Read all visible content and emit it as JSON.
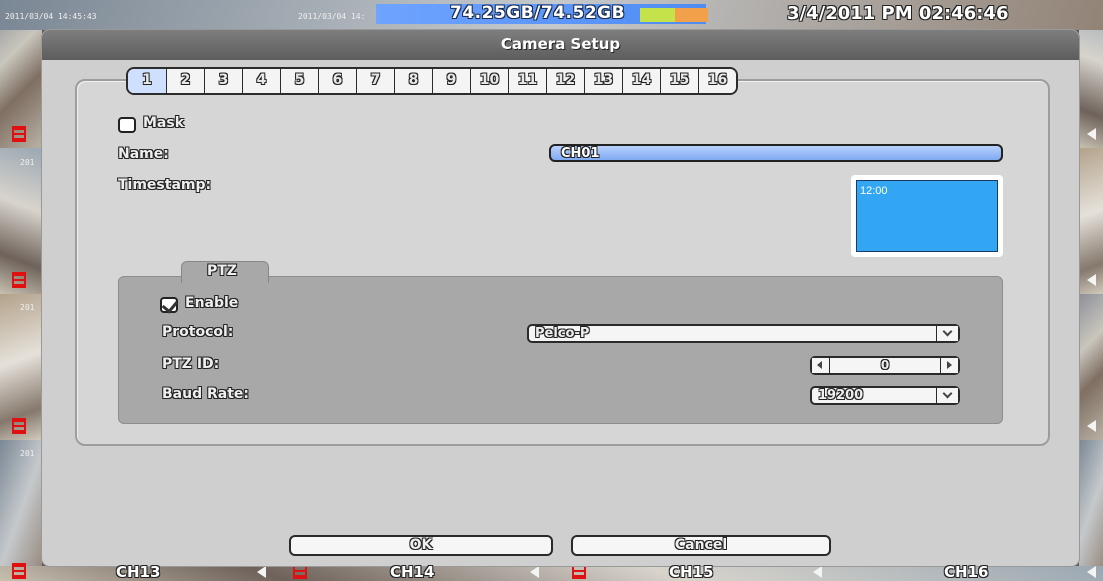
{
  "osd": {
    "feed_timestamp_1": "2011/03/04 14:45:43",
    "feed_timestamp_2": "2011/03/04 14:",
    "feed_partial": "201",
    "storage": "74.25GB/74.52GB",
    "datetime": "3/4/2011 PM 02:46:46",
    "channels": [
      "CH13",
      "CH14",
      "CH15",
      "CH16"
    ]
  },
  "dialog": {
    "title": "Camera Setup",
    "tabs": [
      "1",
      "2",
      "3",
      "4",
      "5",
      "6",
      "7",
      "8",
      "9",
      "10",
      "11",
      "12",
      "13",
      "14",
      "15",
      "16"
    ],
    "active_tab": "1",
    "mask": {
      "label": "Mask",
      "checked": false
    },
    "name": {
      "label": "Name:",
      "value": "CH01"
    },
    "timestamp": {
      "label": "Timestamp:",
      "preview_time": "12:00"
    },
    "ptz": {
      "section_label": "PTZ",
      "enable": {
        "label": "Enable",
        "checked": true
      },
      "protocol": {
        "label": "Protocol:",
        "value": "Pelco-P"
      },
      "ptz_id": {
        "label": "PTZ ID:",
        "value": "0"
      },
      "baud_rate": {
        "label": "Baud Rate:",
        "value": "19200"
      }
    },
    "buttons": {
      "ok": "OK",
      "cancel": "Cancel"
    }
  },
  "colors": {
    "accent_blue": "#6fa3ff",
    "preview_blue": "#33a6f3",
    "record_red": "#e01010"
  }
}
